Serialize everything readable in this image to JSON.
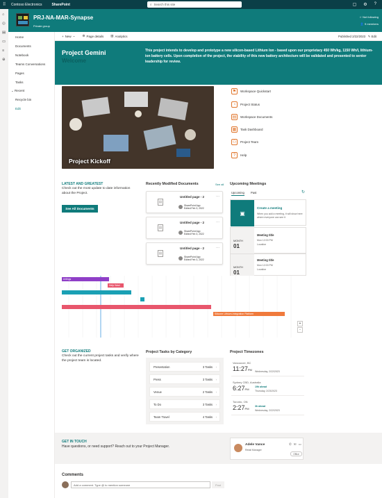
{
  "topbar": {
    "brand": "Contoso Electronics",
    "app": "SharePoint",
    "search_placeholder": "Search this site"
  },
  "header": {
    "site_name": "PRJ-NA-MAR-Synapse",
    "site_sub": "Private group",
    "follow": "Not following",
    "members": "9 members"
  },
  "nav": {
    "items": [
      "Home",
      "Documents",
      "Notebook",
      "Teams Conversations",
      "Pages",
      "Tasks",
      "Recent",
      "Recycle bin",
      "Edit"
    ]
  },
  "commandbar": {
    "new": "New",
    "page_details": "Page details",
    "analytics": "Analytics",
    "published": "Published 2/22/2023",
    "edit": "Edit"
  },
  "hero": {
    "title": "Project Gemini",
    "subtitle": "Welcome",
    "description": "This project intends to develop and prototype a new silicon-based Lithium Ion - based upon our proprietary 450 Wh/kg, 1150 Wh/l, lithium-ion battery cells. Upon completion of the project, the viability of this new battery architecture will be validated and presented to senior leadership for review."
  },
  "kickoff": {
    "caption": "Project Kickoff"
  },
  "quicklinks": [
    "Workspace Quickstart",
    "Project Status",
    "Workspace Documents",
    "Task Dashboard",
    "Project Team",
    "Help"
  ],
  "latest": {
    "heading": "LATEST AND GREATEST",
    "text": "Check out the most update to date information about the Project.",
    "button": "See All Documents"
  },
  "docs": {
    "heading": "Recently Modified Documents",
    "see_all": "See all",
    "items": [
      {
        "title": "Untitled page - 2",
        "author": "SharePoint App",
        "date": "Edited Feb 3, 2022"
      },
      {
        "title": "Untitled page - 2",
        "author": "SharePoint App",
        "date": "Edited Feb 3, 2022"
      },
      {
        "title": "Untitled page - 2",
        "author": "SharePoint App",
        "date": "Edited Feb 3, 2022"
      }
    ]
  },
  "meetings": {
    "heading": "Upcoming Meetings",
    "tab_upcoming": "Upcoming",
    "tab_past": "Past",
    "create_title": "Create a meeting",
    "create_text": "When you add a meeting, it will show here where everyone can see it",
    "items": [
      {
        "month": "MONTH",
        "day": "01",
        "title": "Meeting title",
        "time": "Mon 12:00 PM",
        "location": "Location"
      },
      {
        "month": "MONTH",
        "day": "01",
        "title": "Meeting title",
        "time": "Mon 12:00 PM",
        "location": "Location"
      }
    ]
  },
  "gantt": {
    "bars": [
      {
        "label": "eetings",
        "color": "#8f3fc7",
        "progress": null
      },
      {
        "label": "Help Wanl",
        "color": "#e8566c",
        "progress": null
      },
      {
        "label": "",
        "color": "#1aa0b4",
        "progress": null
      },
      {
        "label": "",
        "color": "#1aa0b4",
        "progress": null
      },
      {
        "label": "",
        "color": "#e8566c",
        "progress": null
      },
      {
        "label": "Silicone Lithium-Integration Platform",
        "color": "#f07a3c",
        "progress": null
      }
    ],
    "zoom_in": "+",
    "zoom_out": "-"
  },
  "organized": {
    "heading": "GET ORGANIZED",
    "text": "Check out the current project tasks and verify where the project team is located."
  },
  "tasks": {
    "heading": "Project Tasks by Category",
    "items": [
      {
        "name": "Presentation",
        "count": "3 Tasks"
      },
      {
        "name": "Press",
        "count": "3 Tasks"
      },
      {
        "name": "Venue",
        "count": "2 Tasks"
      },
      {
        "name": "To Do",
        "count": "3 Tasks"
      },
      {
        "name": "Team Travel",
        "count": "4 Tasks"
      }
    ]
  },
  "timezones": {
    "heading": "Project Timezones",
    "items": [
      {
        "city": "Vancouver, BC",
        "time": "11:27",
        "ampm": "PM",
        "weekday": "",
        "date": "Wednesday, 2/22/2023"
      },
      {
        "city": "Sydney CBD, Australia",
        "time": "6:27",
        "ampm": "PM",
        "weekday": "19h ahead",
        "date": "Thursday, 2/23/2023"
      },
      {
        "city": "Toronto, ON",
        "time": "2:27",
        "ampm": "PM",
        "weekday": "3h ahead",
        "date": "Wednesday, 2/22/2023"
      }
    ]
  },
  "touch": {
    "heading": "GET IN TOUCH",
    "text": "Have questions, or need support? Reach out to your Project Manager.",
    "name": "Adele Vance",
    "role": "Retail Manager",
    "button": "Office"
  },
  "comments": {
    "heading": "Comments",
    "placeholder": "Add a comment. Type @ to mention someone",
    "post": "Post"
  }
}
